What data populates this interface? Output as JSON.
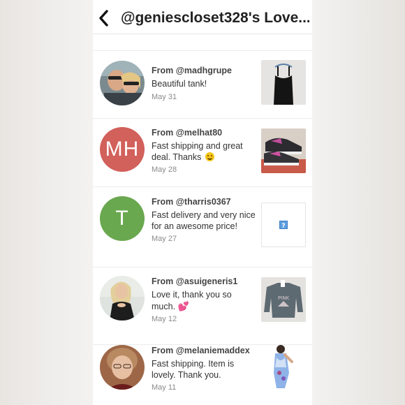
{
  "header": {
    "title": "@geniescloset328's Love...",
    "back_icon": "chevron-left-icon"
  },
  "reviews": [
    {
      "from": "From @madhgrupe",
      "message": "Beautiful tank!",
      "date": "May 31",
      "avatar": "photo",
      "item": "black tank top on hanger"
    },
    {
      "from": "From @melhat80",
      "message": "Fast shipping and great deal. Thanks",
      "emoji": "smiling-face-emoji",
      "date": "May 28",
      "avatar_initials": "MH",
      "avatar_color": "#d2605b",
      "item": "black and pink sneakers"
    },
    {
      "from": "From @tharris0367",
      "message": "Fast delivery and very nice for an awesome price!",
      "date": "May 27",
      "avatar_initials": "T",
      "avatar_color": "#6aa84f",
      "item": "missing image placeholder"
    },
    {
      "from": "From @asuigeneris1",
      "message": "Love it, thank you so much.",
      "emoji": "two-hearts-emoji",
      "date": "May 12",
      "avatar": "photo",
      "item": "grey graphic sweatshirt"
    },
    {
      "from": "From @melaniemaddex",
      "message": "Fast shipping. Item is lovely. Thank you.",
      "date": "May 11",
      "avatar": "photo",
      "item": "blue floral one-piece swimsuit"
    }
  ],
  "colors": {
    "background": "#f3f2f0",
    "header_text": "#222222",
    "avatar_mh": "#d2605b",
    "avatar_t": "#6aa84f"
  }
}
